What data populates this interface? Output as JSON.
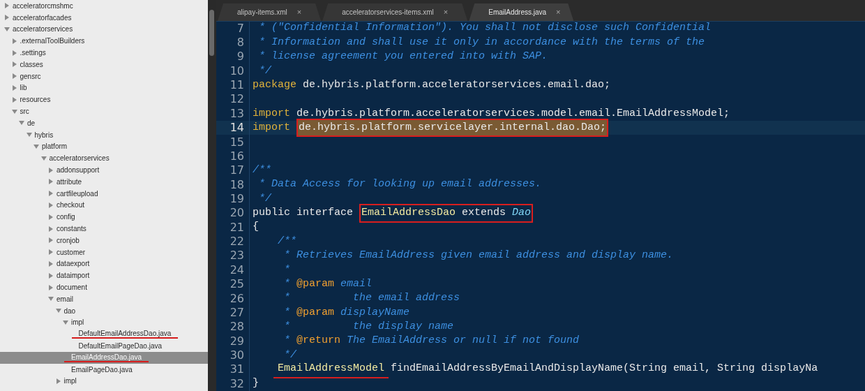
{
  "tree": [
    {
      "label": "acceleratorcmshmc",
      "kind": "folder",
      "expanded": false,
      "selected": false,
      "underlined": false
    },
    {
      "label": "acceleratorfacades",
      "kind": "folder",
      "expanded": false,
      "selected": false,
      "underlined": false
    },
    {
      "label": "acceleratorservices",
      "kind": "folder",
      "expanded": true,
      "selected": false,
      "underlined": false,
      "children": [
        {
          "label": ".externalToolBuilders",
          "kind": "folder",
          "expanded": false,
          "selected": false,
          "underlined": false
        },
        {
          "label": ".settings",
          "kind": "folder",
          "expanded": false,
          "selected": false,
          "underlined": false
        },
        {
          "label": "classes",
          "kind": "folder",
          "expanded": false,
          "selected": false,
          "underlined": false
        },
        {
          "label": "gensrc",
          "kind": "folder",
          "expanded": false,
          "selected": false,
          "underlined": false
        },
        {
          "label": "lib",
          "kind": "folder",
          "expanded": false,
          "selected": false,
          "underlined": false
        },
        {
          "label": "resources",
          "kind": "folder",
          "expanded": false,
          "selected": false,
          "underlined": false
        },
        {
          "label": "src",
          "kind": "folder",
          "expanded": true,
          "selected": false,
          "underlined": false,
          "children": [
            {
              "label": "de",
              "kind": "folder",
              "expanded": true,
              "selected": false,
              "underlined": false,
              "children": [
                {
                  "label": "hybris",
                  "kind": "folder",
                  "expanded": true,
                  "selected": false,
                  "underlined": false,
                  "children": [
                    {
                      "label": "platform",
                      "kind": "folder",
                      "expanded": true,
                      "selected": false,
                      "underlined": false,
                      "children": [
                        {
                          "label": "acceleratorservices",
                          "kind": "folder",
                          "expanded": true,
                          "selected": false,
                          "underlined": false,
                          "children": [
                            {
                              "label": "addonsupport",
                              "kind": "folder",
                              "expanded": false,
                              "selected": false,
                              "underlined": false
                            },
                            {
                              "label": "attribute",
                              "kind": "folder",
                              "expanded": false,
                              "selected": false,
                              "underlined": false
                            },
                            {
                              "label": "cartfileupload",
                              "kind": "folder",
                              "expanded": false,
                              "selected": false,
                              "underlined": false
                            },
                            {
                              "label": "checkout",
                              "kind": "folder",
                              "expanded": false,
                              "selected": false,
                              "underlined": false
                            },
                            {
                              "label": "config",
                              "kind": "folder",
                              "expanded": false,
                              "selected": false,
                              "underlined": false
                            },
                            {
                              "label": "constants",
                              "kind": "folder",
                              "expanded": false,
                              "selected": false,
                              "underlined": false
                            },
                            {
                              "label": "cronjob",
                              "kind": "folder",
                              "expanded": false,
                              "selected": false,
                              "underlined": false
                            },
                            {
                              "label": "customer",
                              "kind": "folder",
                              "expanded": false,
                              "selected": false,
                              "underlined": false
                            },
                            {
                              "label": "dataexport",
                              "kind": "folder",
                              "expanded": false,
                              "selected": false,
                              "underlined": false
                            },
                            {
                              "label": "dataimport",
                              "kind": "folder",
                              "expanded": false,
                              "selected": false,
                              "underlined": false
                            },
                            {
                              "label": "document",
                              "kind": "folder",
                              "expanded": false,
                              "selected": false,
                              "underlined": false
                            },
                            {
                              "label": "email",
                              "kind": "folder",
                              "expanded": true,
                              "selected": false,
                              "underlined": false,
                              "children": [
                                {
                                  "label": "dao",
                                  "kind": "folder",
                                  "expanded": true,
                                  "selected": false,
                                  "underlined": false,
                                  "children": [
                                    {
                                      "label": "impl",
                                      "kind": "folder",
                                      "expanded": true,
                                      "selected": false,
                                      "underlined": false,
                                      "children": [
                                        {
                                          "label": "DefaultEmailAddressDao.java",
                                          "kind": "file",
                                          "selected": false,
                                          "underlined": true
                                        },
                                        {
                                          "label": "DefaultEmailPageDao.java",
                                          "kind": "file",
                                          "selected": false,
                                          "underlined": false
                                        }
                                      ]
                                    },
                                    {
                                      "label": "EmailAddressDao.java",
                                      "kind": "file",
                                      "selected": true,
                                      "underlined": true
                                    },
                                    {
                                      "label": "EmailPageDao.java",
                                      "kind": "file",
                                      "selected": false,
                                      "underlined": false
                                    }
                                  ]
                                },
                                {
                                  "label": "impl",
                                  "kind": "folder",
                                  "expanded": false,
                                  "selected": false,
                                  "underlined": false
                                }
                              ]
                            }
                          ]
                        }
                      ]
                    }
                  ]
                }
              ]
            }
          ]
        }
      ]
    }
  ],
  "tabs": [
    {
      "label": "alipay-items.xml",
      "close": "×",
      "selected": false
    },
    {
      "label": "acceleratorservices-items.xml",
      "close": "×",
      "selected": false
    },
    {
      "label": "EmailAddress.java",
      "close": "×",
      "selected": true
    }
  ],
  "code": [
    {
      "number": "7",
      "current": false,
      "tokens": [
        {
          "text": " * (\"Confidential Information\"). You shall not disclose such Confidential",
          "kind": "comment"
        }
      ]
    },
    {
      "number": "8",
      "current": false,
      "tokens": [
        {
          "text": " * Information and shall use it only in accordance with the terms of the",
          "kind": "comment"
        }
      ]
    },
    {
      "number": "9",
      "current": false,
      "tokens": [
        {
          "text": " * license agreement you entered into with SAP.",
          "kind": "comment"
        }
      ]
    },
    {
      "number": "10",
      "current": false,
      "tokens": [
        {
          "text": " */",
          "kind": "comment"
        }
      ]
    },
    {
      "number": "11",
      "current": false,
      "tokens": [
        {
          "text": "package",
          "kind": "keyword"
        },
        {
          "text": " de.hybris.platform.acceleratorservices.email.dao;",
          "kind": "plain"
        }
      ]
    },
    {
      "number": "12",
      "current": false
    },
    {
      "number": "13",
      "current": false,
      "tokens": [
        {
          "text": "import",
          "kind": "keyword"
        },
        {
          "text": " de.hybris.platform.acceleratorservices.model.email.EmailAddressModel;",
          "kind": "plain"
        }
      ]
    },
    {
      "number": "14",
      "current": true,
      "tokens": [
        {
          "text": "import",
          "kind": "keyword"
        },
        {
          "boxed": true,
          "highlighted": true,
          "parts": [
            {
              "text": "de.hybris.platform.servicelayer.internal.dao.Dao;",
              "kind": "plain"
            }
          ]
        }
      ]
    },
    {
      "number": "15",
      "current": false
    },
    {
      "number": "16",
      "current": false
    },
    {
      "number": "17",
      "current": false,
      "tokens": [
        {
          "text": "/**",
          "kind": "comment"
        }
      ]
    },
    {
      "number": "18",
      "current": false,
      "tokens": [
        {
          "text": " * Data Access for looking up email addresses.",
          "kind": "comment"
        }
      ]
    },
    {
      "number": "19",
      "current": false,
      "tokens": [
        {
          "text": " */",
          "kind": "comment"
        }
      ]
    },
    {
      "number": "20",
      "current": false,
      "tokens": [
        {
          "text": "public interface",
          "kind": "plain"
        },
        {
          "boxed": true,
          "highlighted": false,
          "parts": [
            {
              "text": "EmailAddressDao",
              "kind": "class"
            },
            {
              "text": " extends ",
              "kind": "plain"
            },
            {
              "text": "Dao",
              "kind": "type"
            }
          ]
        }
      ]
    },
    {
      "number": "21",
      "current": false,
      "tokens": [
        {
          "text": "{",
          "kind": "plain"
        }
      ]
    },
    {
      "number": "22",
      "current": false,
      "tokens": [
        {
          "text": "    /**",
          "kind": "comment"
        }
      ]
    },
    {
      "number": "23",
      "current": false,
      "tokens": [
        {
          "text": "     * Retrieves EmailAddress given email address and display name.",
          "kind": "comment"
        }
      ]
    },
    {
      "number": "24",
      "current": false,
      "tokens": [
        {
          "text": "     *",
          "kind": "comment"
        }
      ]
    },
    {
      "number": "25",
      "current": false,
      "tokens": [
        {
          "text": "     * ",
          "kind": "comment"
        },
        {
          "text": "@param",
          "kind": "tag"
        },
        {
          "text": " email",
          "kind": "comment"
        }
      ]
    },
    {
      "number": "26",
      "current": false,
      "tokens": [
        {
          "text": "     *          the email address",
          "kind": "comment"
        }
      ]
    },
    {
      "number": "27",
      "current": false,
      "tokens": [
        {
          "text": "     * ",
          "kind": "comment"
        },
        {
          "text": "@param",
          "kind": "tag"
        },
        {
          "text": " displayName",
          "kind": "comment"
        }
      ]
    },
    {
      "number": "28",
      "current": false,
      "tokens": [
        {
          "text": "     *          the display name",
          "kind": "comment"
        }
      ]
    },
    {
      "number": "29",
      "current": false,
      "tokens": [
        {
          "text": "     * ",
          "kind": "comment"
        },
        {
          "text": "@return",
          "kind": "tag"
        },
        {
          "text": " The EmailAddress or null if not found",
          "kind": "comment"
        }
      ]
    },
    {
      "number": "30",
      "current": false,
      "tokens": [
        {
          "text": "     */",
          "kind": "comment"
        }
      ]
    },
    {
      "number": "31",
      "current": false,
      "indented": true,
      "tokens": [
        {
          "text": "EmailAddressModel",
          "kind": "class",
          "underlined": true
        },
        {
          "text": " findEmailAddressByEmailAndDisplayName(String email, String displayNa",
          "kind": "plain"
        }
      ]
    },
    {
      "number": "32",
      "current": false,
      "tokens": [
        {
          "text": "}",
          "kind": "plain"
        }
      ]
    }
  ]
}
